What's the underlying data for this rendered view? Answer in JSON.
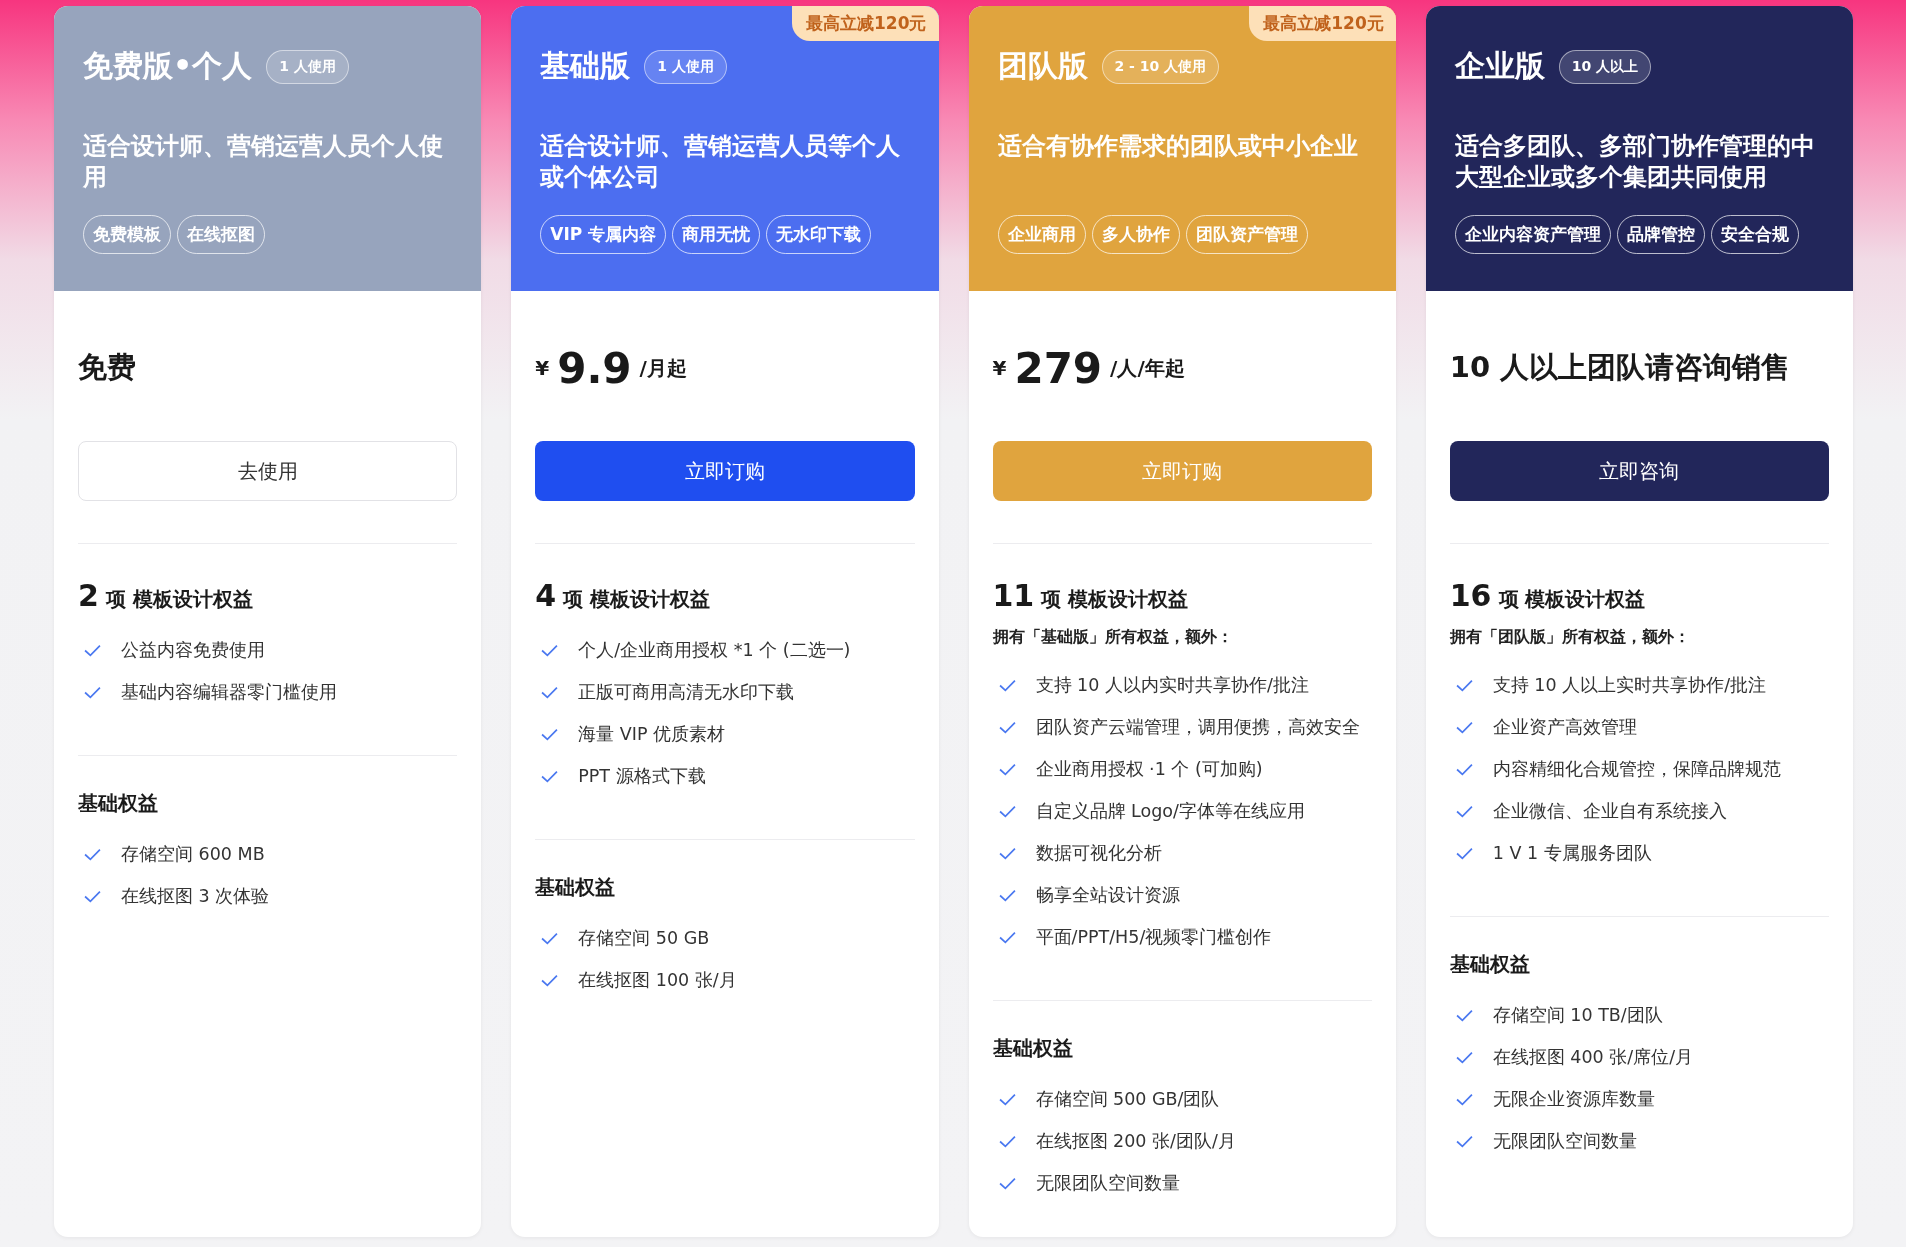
{
  "plans": [
    {
      "name": "免费版•个人",
      "users": "1 人使用",
      "color": "#97a4bd",
      "description": "适合设计师、营销运营人员个人使用",
      "tags": [
        "免费模板",
        "在线抠图"
      ],
      "price": {
        "kind": "text",
        "text": "免费"
      },
      "button": {
        "kind": "outline",
        "label": "去使用"
      },
      "benefits": {
        "count": "2",
        "label": "项 模板设计权益",
        "items": [
          "公益内容免费使用",
          "基础内容编辑器零门槛使用"
        ]
      },
      "basic": {
        "title": "基础权益",
        "items": [
          "存储空间 600 MB",
          "在线抠图 3 次体验"
        ]
      }
    },
    {
      "name": "基础版",
      "users": "1 人使用",
      "color": "#4c6ef0",
      "ribbon": "最高立减120元",
      "description": "适合设计师、营销运营人员等个人或个体公司",
      "tags": [
        "VIP 专属内容",
        "商用无忧",
        "无水印下载"
      ],
      "price": {
        "kind": "amount",
        "currency": "¥",
        "amount": "9.9",
        "unit": "/月起"
      },
      "button": {
        "kind": "filled",
        "label": "立即订购"
      },
      "benefits": {
        "count": "4",
        "label": "项 模板设计权益",
        "items": [
          "个人/企业商用授权 *1 个 (二选一)",
          "正版可商用高清无水印下载",
          "海量 VIP 优质素材",
          "PPT 源格式下载"
        ]
      },
      "basic": {
        "title": "基础权益",
        "items": [
          "存储空间 50 GB",
          "在线抠图 100 张/月"
        ]
      }
    },
    {
      "name": "团队版",
      "users": "2 - 10 人使用",
      "color": "#e0a43e",
      "ribbon": "最高立减120元",
      "description": "适合有协作需求的团队或中小企业",
      "tags": [
        "企业商用",
        "多人协作",
        "团队资产管理"
      ],
      "price": {
        "kind": "amount",
        "currency": "¥",
        "amount": "279",
        "unit": "/人/年起"
      },
      "button": {
        "kind": "filled",
        "label": "立即订购"
      },
      "benefits": {
        "count": "11",
        "label": "项 模板设计权益",
        "note": "拥有「基础版」所有权益，额外：",
        "items": [
          "支持 10 人以内实时共享协作/批注",
          "团队资产云端管理，调用便携，高效安全",
          "企业商用授权 ·1 个 (可加购)",
          "自定义品牌 Logo/字体等在线应用",
          "数据可视化分析",
          "畅享全站设计资源",
          "平面/PPT/H5/视频零门槛创作"
        ]
      },
      "basic": {
        "title": "基础权益",
        "items": [
          "存储空间 500 GB/团队",
          "在线抠图 200 张/团队/月",
          "无限团队空间数量"
        ]
      }
    },
    {
      "name": "企业版",
      "users": "10 人以上",
      "color": "#22265a",
      "description": "适合多团队、多部门协作管理的中大型企业或多个集团共同使用",
      "tags": [
        "企业内容资产管理",
        "品牌管控",
        "安全合规"
      ],
      "price": {
        "kind": "text",
        "text": "10 人以上团队请咨询销售"
      },
      "button": {
        "kind": "filled",
        "label": "立即咨询"
      },
      "benefits": {
        "count": "16",
        "label": "项 模板设计权益",
        "note": "拥有「团队版」所有权益，额外：",
        "items": [
          "支持 10 人以上实时共享协作/批注",
          "企业资产高效管理",
          "内容精细化合规管控，保障品牌规范",
          "企业微信、企业自有系统接入",
          "1 V 1 专属服务团队"
        ]
      },
      "basic": {
        "title": "基础权益",
        "items": [
          "存储空间 10 TB/团队",
          "在线抠图 400 张/席位/月",
          "无限企业资源库数量",
          "无限团队空间数量"
        ]
      }
    }
  ]
}
